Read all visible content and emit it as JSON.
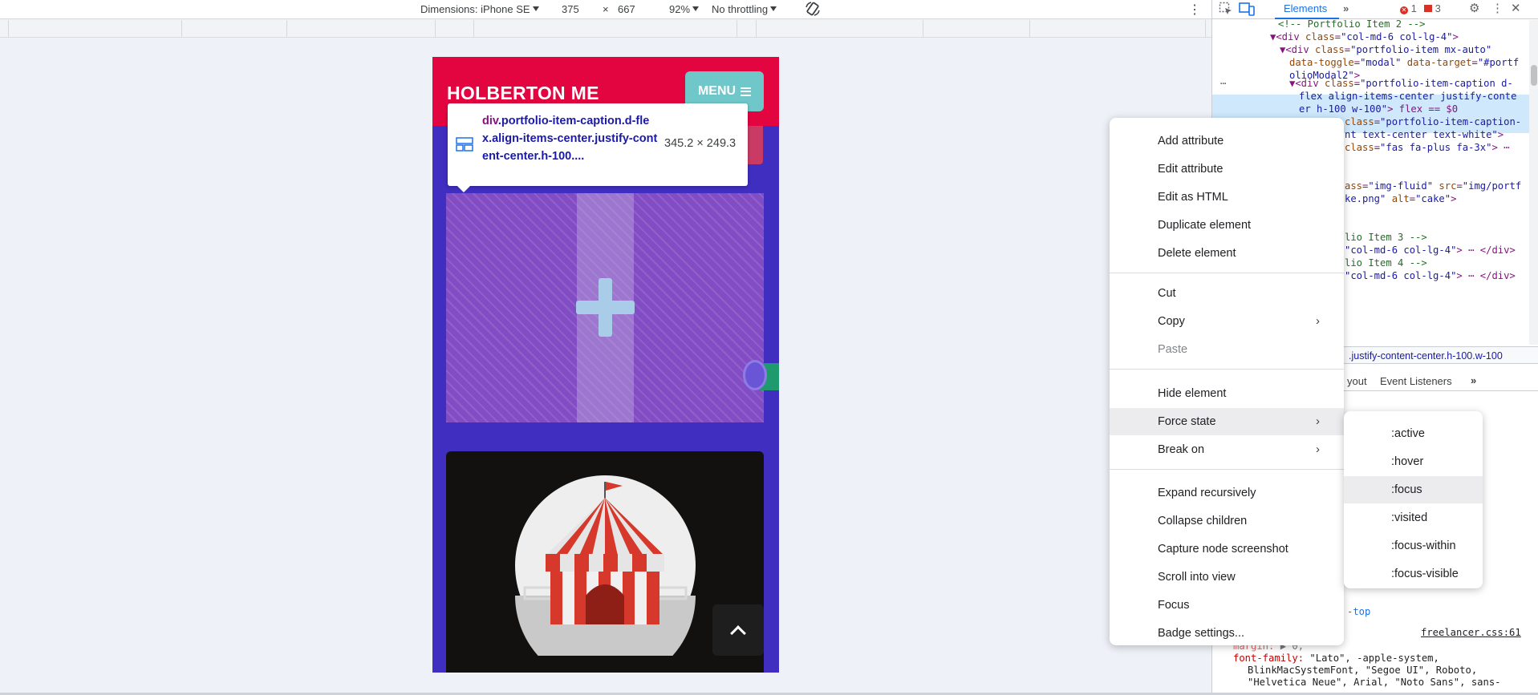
{
  "device_toolbar": {
    "dimensions_label": "Dimensions: iPhone SE",
    "width": "375",
    "times": "×",
    "height": "667",
    "zoom": "92%",
    "throttling": "No throttling"
  },
  "page": {
    "brand": "HOLBERTON ME",
    "menu_label": "MENU"
  },
  "inspect_tooltip": {
    "tag": "div",
    "selector": ".portfolio-item-caption.d-flex.align-items-center.justify-content-center.h-100....",
    "size": "345.2 × 249.3"
  },
  "devtools": {
    "tab": "Elements",
    "more": "»",
    "errors": "1",
    "warnings": "3",
    "dom_lines": [
      {
        "pre": "",
        "cm": "<!-- Portfolio Item 2 -->"
      },
      {
        "tag": "▼<div ",
        "at": "class",
        "av": "\"col-md-6 col-lg-4\"",
        "post": ">"
      },
      {
        "tag": "▼<div ",
        "at": "class",
        "av": "\"portfolio-item mx-auto\"",
        "post": ""
      },
      {
        "tag": "",
        "at": "data-toggle",
        "av": "\"modal\"",
        "at2": " data-target",
        "av2": "\"#portf",
        "post": ""
      },
      {
        "tag": "",
        "av": "olioModal2\"",
        "post": ">"
      },
      {
        "tag": "▼<div ",
        "at": "class",
        "av": "\"portfolio-item-caption d-",
        "post": ""
      },
      {
        "tag": "",
        "av": "flex align-items-center justify-conte",
        "post": ""
      },
      {
        "tag": "",
        "av": "er h-100 w-100\"",
        "post": "> flex == $0"
      },
      {
        "tag": "",
        "at": "class",
        "av": "\"portfolio-item-caption-",
        "post": ""
      },
      {
        "tag": "",
        "av": "nt text-center text-white\"",
        "post": ">"
      },
      {
        "tag": "",
        "at": "class",
        "av": "\"fas fa-plus fa-3x\"",
        "post": "> ⋯"
      },
      {
        "tag": "",
        "post": ""
      },
      {
        "tag": "",
        "post": ""
      },
      {
        "tag": "",
        "at": "ass",
        "av": "\"img-fluid\"",
        "at2": " src",
        "av2": "\"img/portf",
        "post": ""
      },
      {
        "tag": "",
        "av": "ke.png\"",
        "at2": " alt",
        "av2": "\"cake\"",
        "post": ">"
      },
      {
        "tag": "",
        "post": ""
      },
      {
        "tag": "",
        "post": ""
      },
      {
        "tag": "",
        "cm": "lio Item 3 -->"
      },
      {
        "tag": "",
        "av": "\"col-md-6 col-lg-4\"",
        "post": "> ⋯ </div>"
      },
      {
        "tag": "",
        "cm": "lio Item 4 -->"
      },
      {
        "tag": "",
        "av": "\"col-md-6 col-lg-4\"",
        "post": "> ⋯ </div>"
      }
    ],
    "breadcrumb": ".justify-content-center.h-100.w-100",
    "subtabs": [
      "yout",
      "Event Listeners",
      "»"
    ],
    "styles": {
      "selector_tail": "-top",
      "source": "freelancer.css:61",
      "margin_prop": "margin",
      "margin_val": "▶ 0;",
      "font_prop": "font-family",
      "font_val_1": "\"Lato\", -apple-system,",
      "font_val_2": "BlinkMacSystemFont, \"Segoe UI\", Roboto,",
      "font_val_3": "\"Helvetica Neue\", Arial, \"Noto Sans\", sans-"
    }
  },
  "context_menu": {
    "items": [
      {
        "label": "Add attribute"
      },
      {
        "label": "Edit attribute"
      },
      {
        "label": "Edit as HTML"
      },
      {
        "label": "Duplicate element"
      },
      {
        "label": "Delete element"
      },
      {
        "label": "Cut"
      },
      {
        "label": "Copy",
        "submenu": true
      },
      {
        "label": "Paste",
        "disabled": true
      },
      {
        "label": "Hide element"
      },
      {
        "label": "Force state",
        "submenu": true,
        "active": true
      },
      {
        "label": "Break on",
        "submenu": true
      },
      {
        "label": "Expand recursively"
      },
      {
        "label": "Collapse children"
      },
      {
        "label": "Capture node screenshot"
      },
      {
        "label": "Scroll into view"
      },
      {
        "label": "Focus"
      },
      {
        "label": "Badge settings..."
      }
    ],
    "submenu_arrow": "›",
    "force_state_submenu": [
      ":active",
      ":hover",
      ":focus",
      ":visited",
      ":focus-within",
      ":focus-visible"
    ]
  },
  "colors": {
    "nav_red": "#e3053f",
    "page_purple": "#3f2ec0",
    "menu_teal": "#6fc7c9",
    "accent_blue": "#1a73e8"
  }
}
